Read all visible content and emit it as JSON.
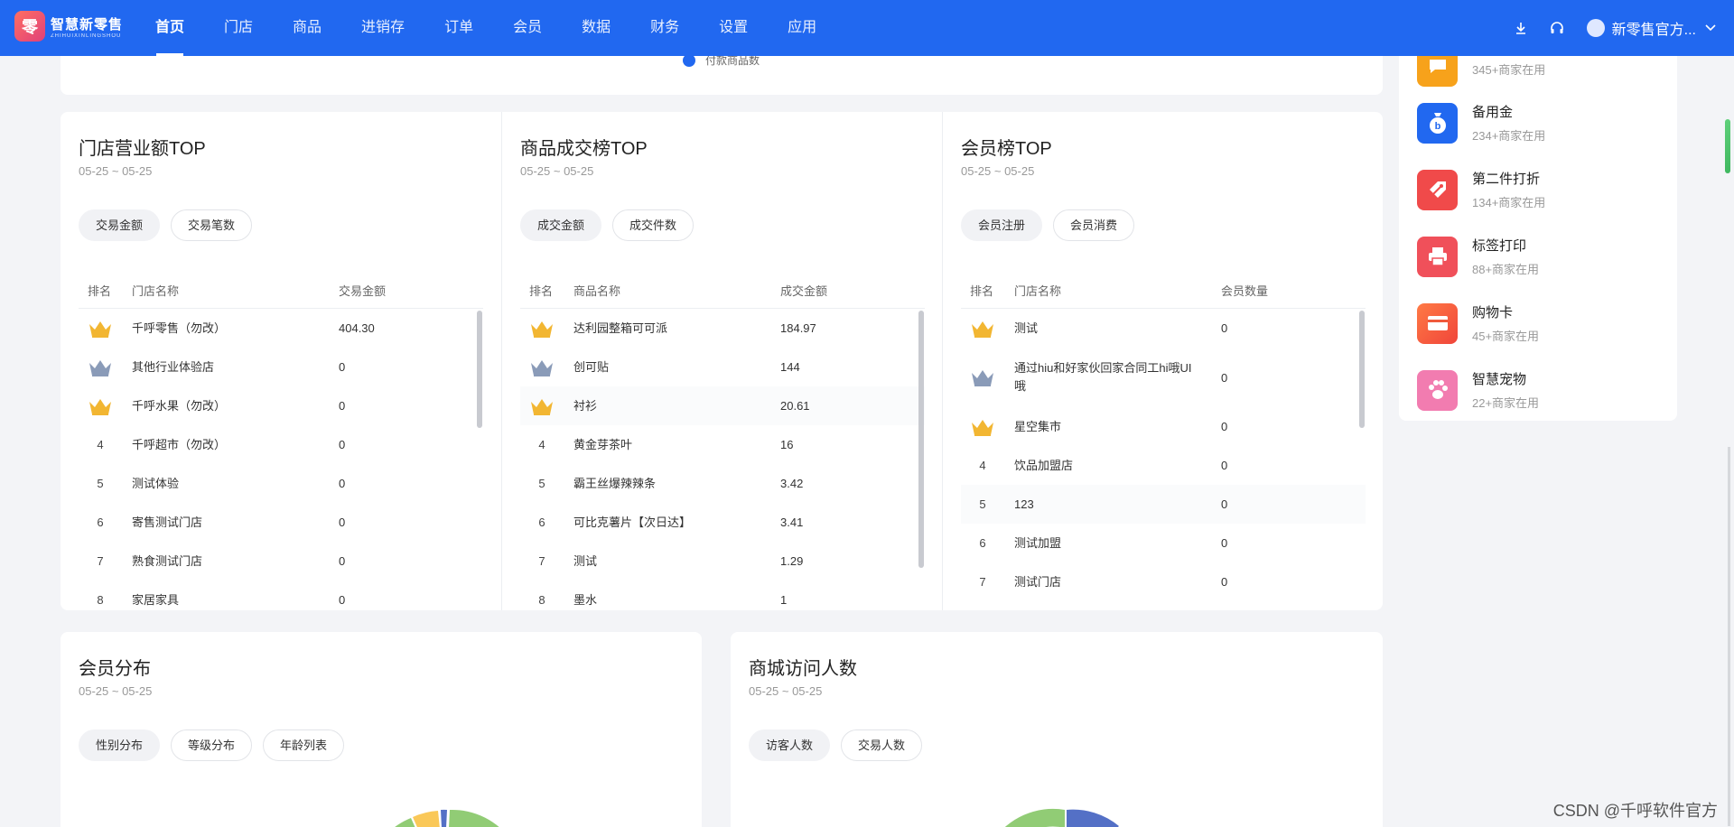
{
  "brand": {
    "name_cn": "智慧新零售",
    "name_en": "ZHIHUIXINLINGSHOU",
    "mark": "零"
  },
  "nav": {
    "items": [
      {
        "label": "首页"
      },
      {
        "label": "门店"
      },
      {
        "label": "商品"
      },
      {
        "label": "进销存"
      },
      {
        "label": "订单"
      },
      {
        "label": "会员"
      },
      {
        "label": "数据"
      },
      {
        "label": "财务"
      },
      {
        "label": "设置"
      },
      {
        "label": "应用"
      }
    ],
    "active": "首页",
    "user_name": "新零售官方...",
    "icons": [
      "download-icon",
      "headset-icon",
      "chevron-down-icon"
    ]
  },
  "top_card": {
    "legend": "付款商品数"
  },
  "stores_top": {
    "title": "门店营业额TOP",
    "date": "05-25 ~ 05-25",
    "tabs": [
      "交易金额",
      "交易笔数"
    ],
    "headers": [
      "排名",
      "门店名称",
      "交易金额"
    ],
    "rows": [
      {
        "rank": "1",
        "name": "千呼零售（勿改）",
        "value": "404.30"
      },
      {
        "rank": "2",
        "name": "其他行业体验店",
        "value": "0"
      },
      {
        "rank": "3",
        "name": "千呼水果（勿改）",
        "value": "0"
      },
      {
        "rank": "4",
        "name": "千呼超市（勿改）",
        "value": "0"
      },
      {
        "rank": "5",
        "name": "测试体验",
        "value": "0"
      },
      {
        "rank": "6",
        "name": "寄售测试门店",
        "value": "0"
      },
      {
        "rank": "7",
        "name": "熟食测试门店",
        "value": "0"
      },
      {
        "rank": "8",
        "name": "家居家具",
        "value": "0"
      }
    ]
  },
  "goods_top": {
    "title": "商品成交榜TOP",
    "date": "05-25 ~ 05-25",
    "tabs": [
      "成交金额",
      "成交件数"
    ],
    "headers": [
      "排名",
      "商品名称",
      "成交金额"
    ],
    "rows": [
      {
        "rank": "1",
        "name": "达利园整箱可可派",
        "value": "184.97"
      },
      {
        "rank": "2",
        "name": "创可贴",
        "value": "144"
      },
      {
        "rank": "3",
        "name": "衬衫",
        "value": "20.61"
      },
      {
        "rank": "4",
        "name": "黄金芽茶叶",
        "value": "16"
      },
      {
        "rank": "5",
        "name": "霸王丝爆辣辣条",
        "value": "3.42"
      },
      {
        "rank": "6",
        "name": "可比克薯片【次日达】",
        "value": "3.41"
      },
      {
        "rank": "7",
        "name": "测试",
        "value": "1.29"
      },
      {
        "rank": "8",
        "name": "墨水",
        "value": "1"
      }
    ]
  },
  "members_top": {
    "title": "会员榜TOP",
    "date": "05-25 ~ 05-25",
    "tabs": [
      "会员注册",
      "会员消费"
    ],
    "headers": [
      "排名",
      "门店名称",
      "会员数量"
    ],
    "rows": [
      {
        "rank": "1",
        "name": "测试",
        "value": "0"
      },
      {
        "rank": "2",
        "name": "通过hiu和好家伙回家合同工hi哦UI哦",
        "value": "0"
      },
      {
        "rank": "3",
        "name": "星空集市",
        "value": "0"
      },
      {
        "rank": "4",
        "name": "饮品加盟店",
        "value": "0"
      },
      {
        "rank": "5",
        "name": "123",
        "value": "0"
      },
      {
        "rank": "6",
        "name": "测试加盟",
        "value": "0"
      },
      {
        "rank": "7",
        "name": "测试门店",
        "value": "0"
      }
    ]
  },
  "member_dist": {
    "title": "会员分布",
    "date": "05-25 ~ 05-25",
    "tabs": [
      "性别分布",
      "等级分布",
      "年龄列表"
    ]
  },
  "mall_visitors": {
    "title": "商城访问人数",
    "date": "05-25 ~ 05-25",
    "tabs": [
      "访客人数",
      "交易人数"
    ]
  },
  "apps": [
    {
      "name": "",
      "sub": "345+商家在用",
      "color": "#f7a21b",
      "icon": "chat-icon"
    },
    {
      "name": "备用金",
      "sub": "234+商家在用",
      "color": "#2168f0",
      "icon": "money-bag-icon"
    },
    {
      "name": "第二件打折",
      "sub": "134+商家在用",
      "color": "#f04a4a",
      "icon": "discount-tag-icon"
    },
    {
      "name": "标签打印",
      "sub": "88+商家在用",
      "color": "#f0505a",
      "icon": "printer-icon"
    },
    {
      "name": "购物卡",
      "sub": "45+商家在用",
      "color": "#f05a3c",
      "icon": "card-icon"
    },
    {
      "name": "智慧宠物",
      "sub": "22+商家在用",
      "color": "#f27cb0",
      "icon": "paw-icon"
    }
  ],
  "watermark": "CSDN @千呼软件官方",
  "colors": {
    "primary": "#2168f0",
    "gold": "#f2b632",
    "silver": "#8a9bb8",
    "donut_green": "#91cc75",
    "donut_yellow": "#fac858",
    "donut_blue": "#5470c6"
  }
}
